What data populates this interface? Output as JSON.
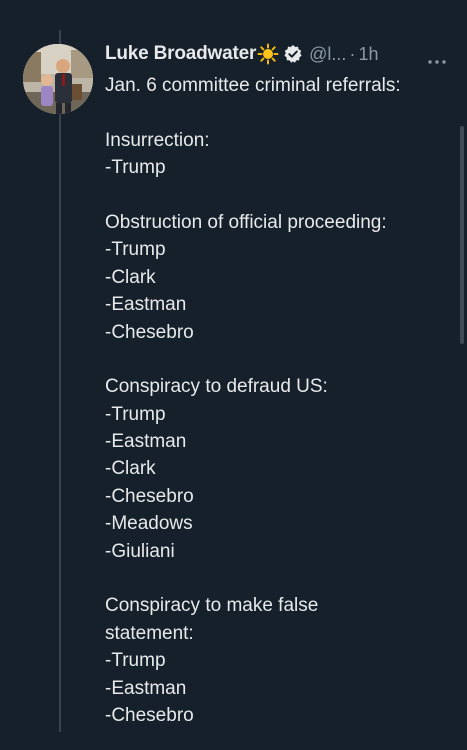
{
  "author": {
    "name": "Luke Broadwater",
    "handle": "@l...",
    "separator": "·",
    "time": "1h",
    "emoji_icon": "sun-icon",
    "verified_icon": "verified-badge-icon"
  },
  "tweet": {
    "lines": [
      "Jan. 6 committee criminal referrals:",
      "",
      "Insurrection:",
      "-Trump",
      "",
      "Obstruction of official proceeding:",
      "-Trump",
      "-Clark",
      "-Eastman",
      "-Chesebro",
      "",
      "Conspiracy to defraud US:",
      "-Trump",
      "-Eastman",
      "-Clark",
      "-Chesebro",
      "-Meadows",
      "-Giuliani",
      "",
      "Conspiracy to make false",
      "statement:",
      "-Trump",
      "-Eastman",
      "-Chesebro"
    ]
  },
  "colors": {
    "background": "#15202b",
    "text": "#e7e9ea",
    "muted": "#8b98a5",
    "thread_line": "#38444d"
  },
  "icons": {
    "more": "more-dots-icon"
  }
}
